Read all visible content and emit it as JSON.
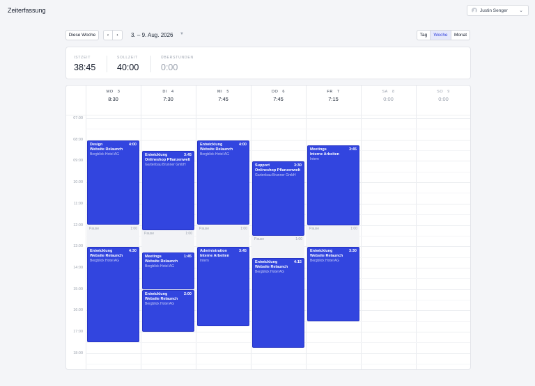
{
  "app": {
    "title": "Zeiterfassung"
  },
  "user": {
    "name": "Justin Senger"
  },
  "toolbar": {
    "today_label": "Diese Woche",
    "range_label": "3. – 9. Aug. 2026",
    "views": [
      {
        "label": "Tag",
        "active": false
      },
      {
        "label": "Woche",
        "active": true
      },
      {
        "label": "Monat",
        "active": false
      }
    ]
  },
  "stats": [
    {
      "label": "ISTZEIT",
      "value": "38:45",
      "muted": false
    },
    {
      "label": "SOLLZEIT",
      "value": "40:00",
      "muted": false
    },
    {
      "label": "ÜBERSTUNDEN",
      "value": "0:00",
      "muted": true
    }
  ],
  "hours": [
    "07:00",
    "08:00",
    "09:00",
    "10:00",
    "11:00",
    "12:00",
    "13:00",
    "14:00",
    "15:00",
    "16:00",
    "17:00",
    "18:00"
  ],
  "days": [
    {
      "name": "MO",
      "num": "3",
      "total": "8:30",
      "weekend": false
    },
    {
      "name": "DI",
      "num": "4",
      "total": "7:30",
      "weekend": false
    },
    {
      "name": "MI",
      "num": "5",
      "total": "7:45",
      "weekend": false
    },
    {
      "name": "DO",
      "num": "6",
      "total": "7:45",
      "weekend": false
    },
    {
      "name": "FR",
      "num": "7",
      "total": "7:15",
      "weekend": false
    },
    {
      "name": "SA",
      "num": "8",
      "total": "0:00",
      "weekend": true
    },
    {
      "name": "SO",
      "num": "9",
      "total": "0:00",
      "weekend": true
    }
  ],
  "events": [
    {
      "day": 0,
      "start": 8,
      "end": 12,
      "category": "Design",
      "duration": "4:00",
      "project": "Website Relaunch",
      "client": "Bergblick Hotel AG"
    },
    {
      "day": 0,
      "start": 13,
      "end": 17.5,
      "category": "Entwicklung",
      "duration": "4:30",
      "project": "Website Relaunch",
      "client": "Bergblick Hotel AG"
    },
    {
      "day": 1,
      "start": 8.5,
      "end": 12.25,
      "category": "Entwicklung",
      "duration": "3:45",
      "project": "Onlineshop Pflanzenwelt",
      "client": "Gartenbau Brunner GmbH"
    },
    {
      "day": 1,
      "start": 13.25,
      "end": 15,
      "category": "Meetings",
      "duration": "1:45",
      "project": "Website Relaunch",
      "client": "Bergblick Hotel AG"
    },
    {
      "day": 1,
      "start": 15,
      "end": 17,
      "category": "Entwicklung",
      "duration": "2:00",
      "project": "Website Relaunch",
      "client": "Bergblick Hotel AG"
    },
    {
      "day": 2,
      "start": 8,
      "end": 12,
      "category": "Entwicklung",
      "duration": "4:00",
      "project": "Website Relaunch",
      "client": "Bergblick Hotel AG"
    },
    {
      "day": 2,
      "start": 13,
      "end": 16.75,
      "category": "Administration",
      "duration": "3:45",
      "project": "Interne Arbeiten",
      "client": "Intern"
    },
    {
      "day": 3,
      "start": 9,
      "end": 12.5,
      "category": "Support",
      "duration": "3:30",
      "project": "Onlineshop Pflanzenwelt",
      "client": "Gartenbau Brunner GmbH"
    },
    {
      "day": 3,
      "start": 13.5,
      "end": 17.75,
      "category": "Entwicklung",
      "duration": "4:15",
      "project": "Website Relaunch",
      "client": "Bergblick Hotel AG"
    },
    {
      "day": 4,
      "start": 8.25,
      "end": 12,
      "category": "Meetings",
      "duration": "3:45",
      "project": "Interne Arbeiten",
      "client": "Intern"
    },
    {
      "day": 4,
      "start": 13,
      "end": 16.5,
      "category": "Entwicklung",
      "duration": "3:30",
      "project": "Website Relaunch",
      "client": "Bergblick Hotel AG"
    }
  ],
  "pauses": [
    {
      "day": 0,
      "start": 12,
      "end": 13,
      "label": "Pause",
      "duration": "1:00"
    },
    {
      "day": 1,
      "start": 12.25,
      "end": 13.25,
      "label": "Pause",
      "duration": "1:00"
    },
    {
      "day": 2,
      "start": 12,
      "end": 13,
      "label": "Pause",
      "duration": "1:00"
    },
    {
      "day": 3,
      "start": 12.5,
      "end": 13.5,
      "label": "Pause",
      "duration": "1:00"
    },
    {
      "day": 4,
      "start": 12,
      "end": 13,
      "label": "Pause",
      "duration": "1:00"
    }
  ],
  "colors": {
    "event": "#3245df",
    "accent": "#2f3fdc"
  }
}
